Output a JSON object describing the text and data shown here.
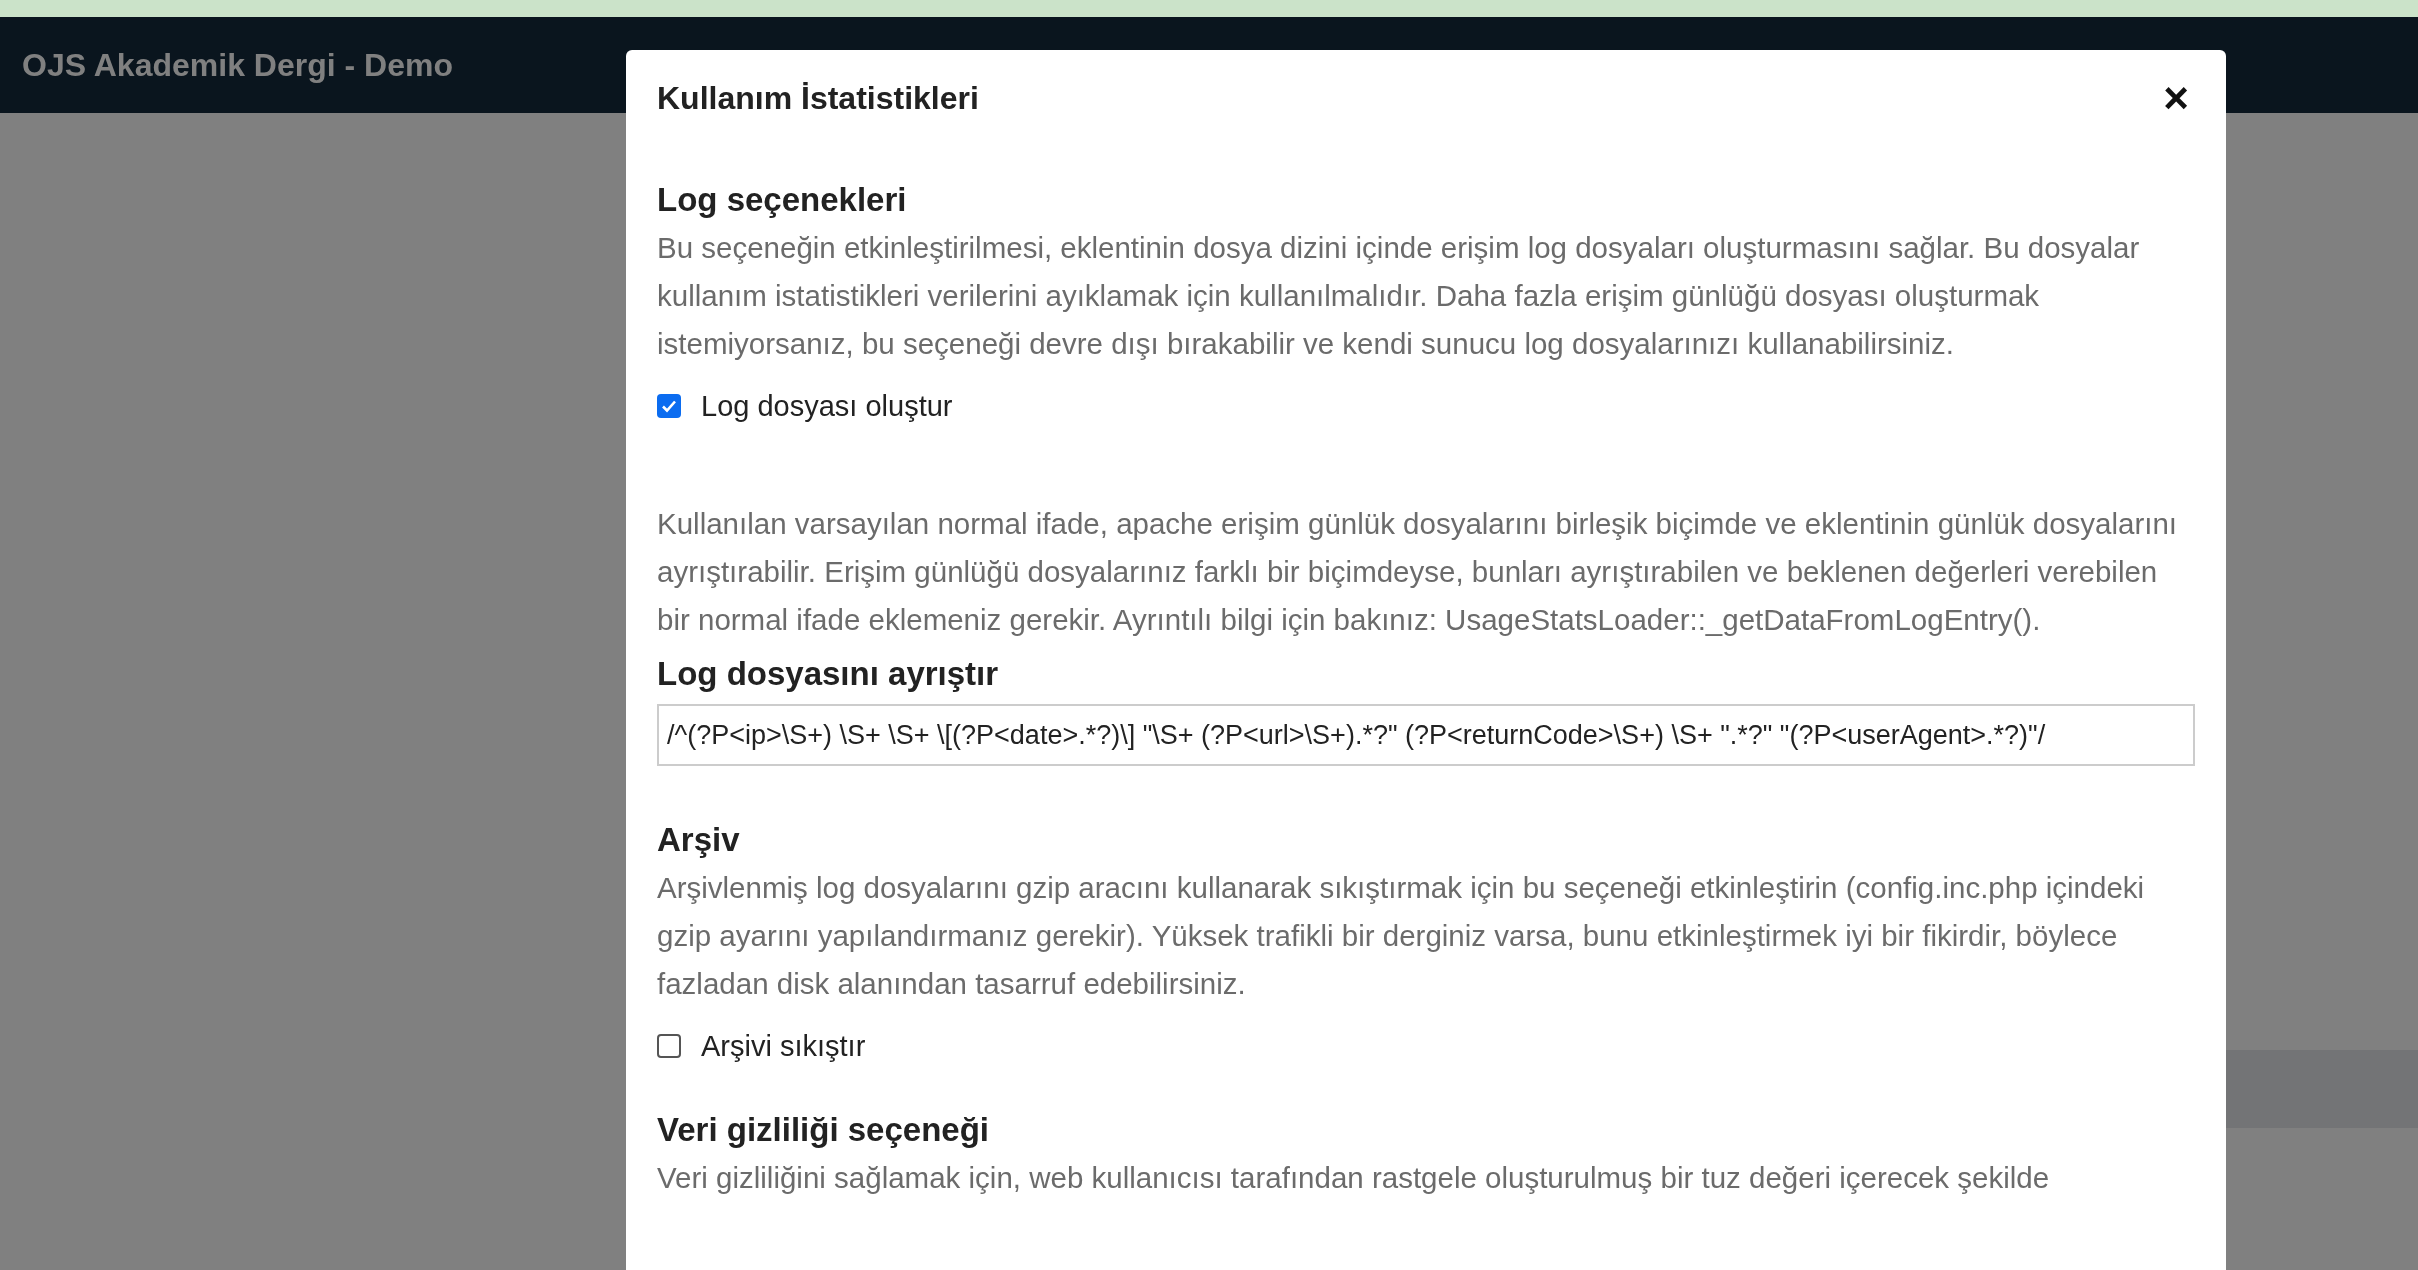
{
  "site_header": {
    "title": "OJS Akademik Dergi - Demo"
  },
  "modal": {
    "title": "Kullanım İstatistikleri",
    "close": "×",
    "sections": [
      {
        "kind": "checkbox",
        "heading": "Log seçenekleri",
        "text": "Bu seçeneğin etkinleştirilmesi, eklentinin dosya dizini içinde erişim log dosyaları oluşturmasını sağlar. Bu dosyalar kullanım istatistikleri verilerini ayıklamak için kullanılmalıdır. Daha fazla erişim günlüğü dosyası oluşturmak istemiyorsanız, bu seçeneği devre dışı bırakabilir ve kendi sunucu log dosyalarınızı kullanabilirsiniz.",
        "label": "Log dosyası oluştur",
        "checked": true
      },
      {
        "kind": "input",
        "intro": "Kullanılan varsayılan normal ifade, apache erişim günlük dosyalarını birleşik biçimde ve eklentinin günlük dosyalarını ayrıştırabilir. Erişim günlüğü dosyalarınız farklı bir biçimdeyse, bunları ayrıştırabilen ve beklenen değerleri verebilen bir normal ifade eklemeniz gerekir. Ayrıntılı bilgi için bakınız: UsageStatsLoader::_getDataFromLogEntry().",
        "heading": "Log dosyasını ayrıştır",
        "value": "/^(?P<ip>\\S+) \\S+ \\S+ \\[(?P<date>.*?)\\] \"\\S+ (?P<url>\\S+).*?\" (?P<returnCode>\\S+) \\S+ \".*?\" \"(?P<userAgent>.*?)\"/"
      },
      {
        "kind": "checkbox",
        "heading": "Arşiv",
        "text": "Arşivlenmiş log dosyalarını gzip aracını kullanarak sıkıştırmak için bu seçeneği etkinleştirin (config.inc.php içindeki gzip ayarını yapılandırmanız gerekir). Yüksek trafikli bir derginiz varsa, bunu etkinleştirmek iyi bir fikirdir, böylece fazladan disk alanından tasarruf edebilirsiniz.",
        "label": "Arşivi sıkıştır",
        "checked": false
      },
      {
        "kind": "text",
        "heading": "Veri gizliliği seçeneği",
        "text": "Veri gizliliğini sağlamak için, web kullanıcısı tarafından rastgele oluşturulmuş bir tuz değeri içerecek şekilde"
      }
    ]
  }
}
